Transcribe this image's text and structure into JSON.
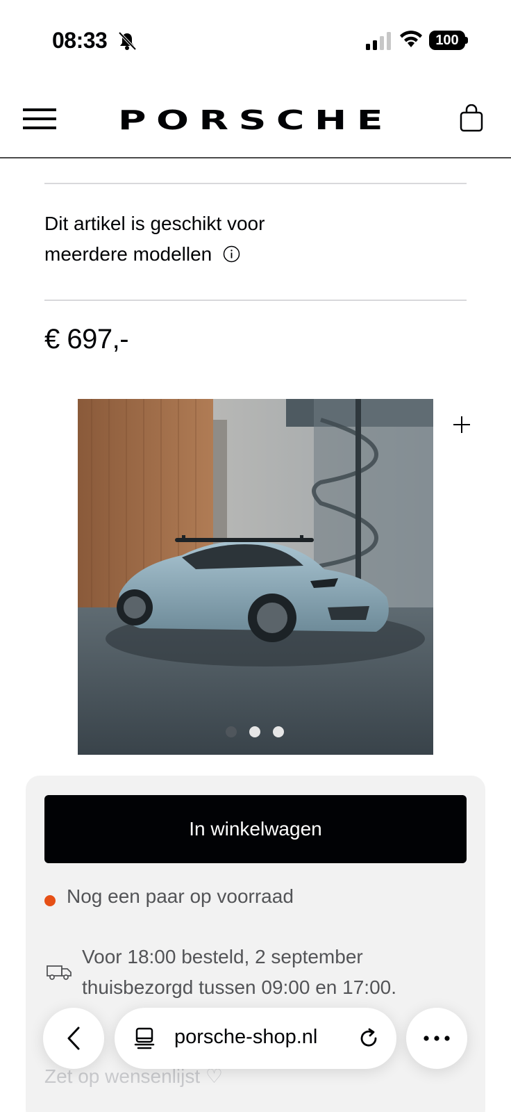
{
  "status_bar": {
    "time": "08:33",
    "battery": "100",
    "icons": [
      "bell-slash-icon",
      "signal-icon",
      "wifi-icon",
      "battery-icon"
    ]
  },
  "header": {
    "brand": "PORSCHE",
    "icons": [
      "menu-icon",
      "shopping-bag-icon"
    ]
  },
  "product": {
    "compatibility_line1": "Dit artikel is geschikt voor",
    "compatibility_line2": "meerdere modellen",
    "info_icon": "info-icon",
    "price": "€ 697,-",
    "gallery": {
      "slides": 3,
      "active_slide": 1,
      "zoom_icon": "plus-icon"
    }
  },
  "purchase": {
    "add_to_cart": "In winkelwagen",
    "stock_status": "Nog een paar op voorraad",
    "stock_color": "#e65016",
    "delivery_line1": "Voor 18:00 besteld, 2 september",
    "delivery_line2": "thuisbezorgd tussen 09:00 en 17:00.",
    "wishlist": "Zet op wensenlijst ♡"
  },
  "browser": {
    "url": "porsche-shop.nl",
    "icons": [
      "back-icon",
      "page-icon",
      "reload-icon",
      "more-icon"
    ]
  },
  "colors": {
    "primary": "#010205",
    "panel": "#f2f2f2",
    "muted_text": "#535457"
  }
}
